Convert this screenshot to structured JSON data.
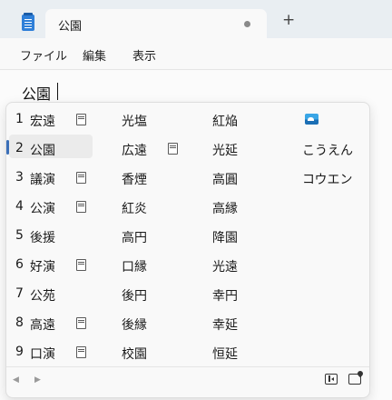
{
  "window": {
    "tab_title": "公園",
    "new_tab_label": "+",
    "menu": [
      "ファイル",
      "編集",
      "表示"
    ]
  },
  "editor": {
    "composition_text": "公園"
  },
  "ime": {
    "selected_index": 2,
    "numbers": [
      "1",
      "2",
      "3",
      "4",
      "5",
      "6",
      "7",
      "8",
      "9"
    ],
    "col1": [
      "宏遠",
      "公園",
      "議演",
      "公演",
      "後援",
      "好演",
      "公苑",
      "高遠",
      "口演"
    ],
    "col2": [
      "光塩",
      "広遠",
      "香煙",
      "紅炎",
      "高円",
      "口縁",
      "後円",
      "後縁",
      "校園"
    ],
    "col3": [
      "紅焔",
      "光延",
      "高圓",
      "高縁",
      "降園",
      "光遠",
      "幸円",
      "幸延",
      "恒延"
    ],
    "col4": [
      "",
      "こうえん",
      "コウエン"
    ],
    "footer": {
      "prev": "◀",
      "next": "▶"
    }
  }
}
